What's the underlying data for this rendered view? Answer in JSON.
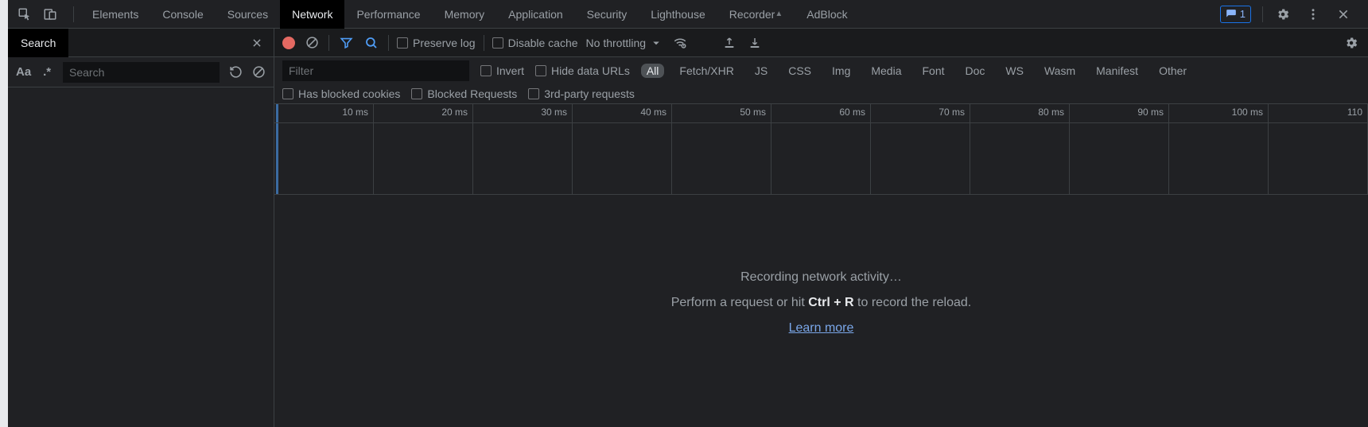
{
  "tabs": {
    "items": [
      "Elements",
      "Console",
      "Sources",
      "Network",
      "Performance",
      "Memory",
      "Application",
      "Security",
      "Lighthouse",
      "Recorder",
      "AdBlock"
    ],
    "active": "Network"
  },
  "issues_count": "1",
  "search_panel": {
    "title": "Search",
    "placeholder": "Search"
  },
  "net_toolbar": {
    "preserve_log": "Preserve log",
    "disable_cache": "Disable cache",
    "throttling": "No throttling"
  },
  "filter": {
    "placeholder": "Filter",
    "invert": "Invert",
    "hide_data_urls": "Hide data URLs",
    "types": [
      "All",
      "Fetch/XHR",
      "JS",
      "CSS",
      "Img",
      "Media",
      "Font",
      "Doc",
      "WS",
      "Wasm",
      "Manifest",
      "Other"
    ],
    "type_active": "All",
    "blocked_cookies": "Has blocked cookies",
    "blocked_requests": "Blocked Requests",
    "third_party": "3rd-party requests"
  },
  "timeline": {
    "ticks": [
      "10 ms",
      "20 ms",
      "30 ms",
      "40 ms",
      "50 ms",
      "60 ms",
      "70 ms",
      "80 ms",
      "90 ms",
      "100 ms",
      "110"
    ]
  },
  "empty_state": {
    "line1": "Recording network activity…",
    "line2_a": "Perform a request or hit ",
    "line2_b": "Ctrl + R",
    "line2_c": " to record the reload.",
    "learn_more": "Learn more"
  }
}
